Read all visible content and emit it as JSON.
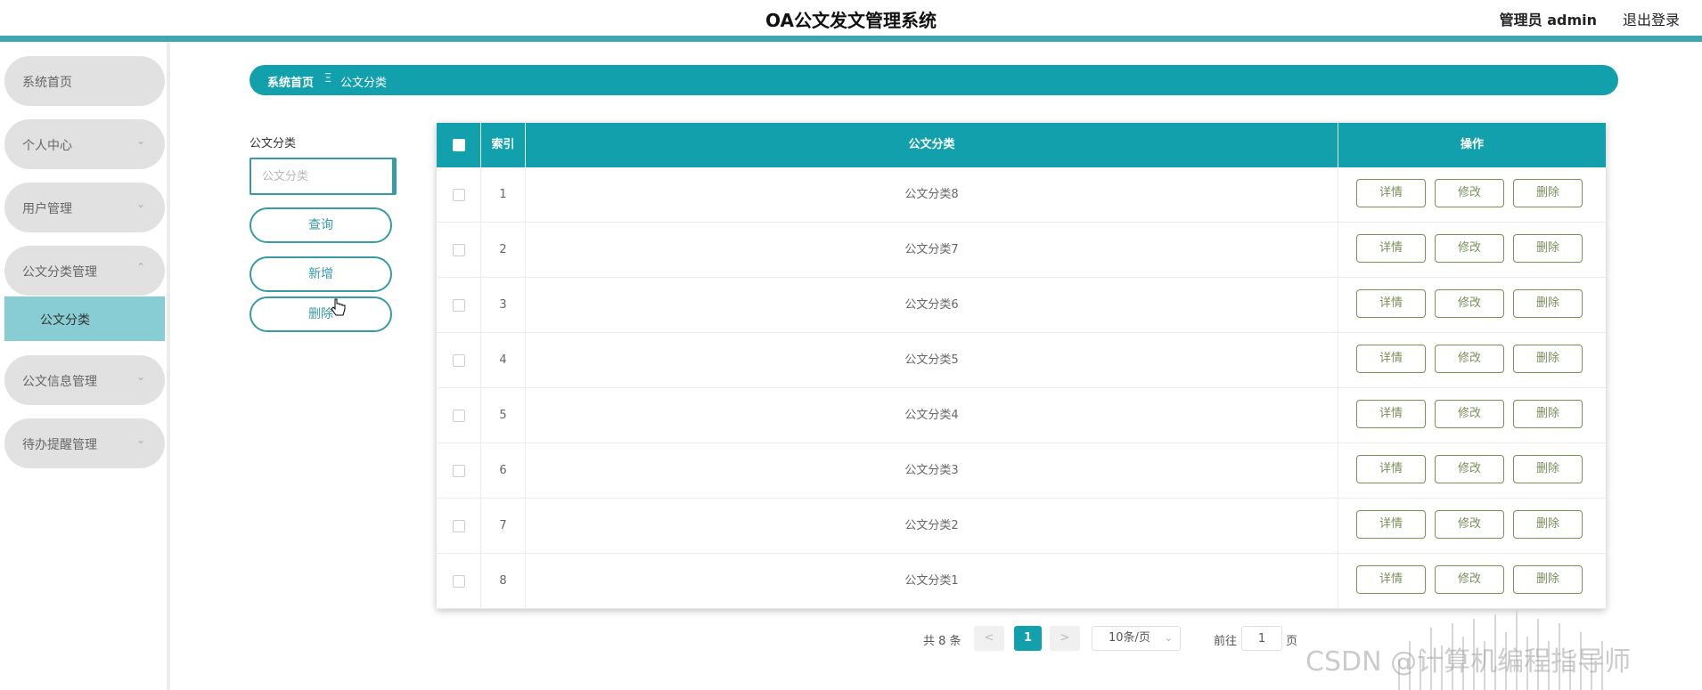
{
  "header": {
    "title": "OA公文发文管理系统",
    "user": "管理员 admin",
    "logout": "退出登录"
  },
  "sidebar": {
    "items": [
      {
        "label": "系统首页",
        "arrow": ""
      },
      {
        "label": "个人中心",
        "arrow": "⌄"
      },
      {
        "label": "用户管理",
        "arrow": "⌄"
      },
      {
        "label": "公文分类管理",
        "arrow": "⌃"
      },
      {
        "label": "公文信息管理",
        "arrow": "⌄"
      },
      {
        "label": "待办提醒管理",
        "arrow": "⌄"
      }
    ],
    "active_sub": "公文分类"
  },
  "breadcrumb": {
    "home": "系统首页",
    "separator": "Ξ",
    "current": "公文分类"
  },
  "search": {
    "label": "公文分类",
    "placeholder": "公文分类",
    "query_button": "查询",
    "add_button": "新增",
    "delete_button": "删除"
  },
  "table": {
    "headers": {
      "index": "索引",
      "name": "公文分类",
      "ops": "操作"
    },
    "rows": [
      {
        "index": "1",
        "name": "公文分类8"
      },
      {
        "index": "2",
        "name": "公文分类7"
      },
      {
        "index": "3",
        "name": "公文分类6"
      },
      {
        "index": "4",
        "name": "公文分类5"
      },
      {
        "index": "5",
        "name": "公文分类4"
      },
      {
        "index": "6",
        "name": "公文分类3"
      },
      {
        "index": "7",
        "name": "公文分类2"
      },
      {
        "index": "8",
        "name": "公文分类1"
      }
    ],
    "ops": {
      "detail": "详情",
      "edit": "修改",
      "delete": "删除"
    }
  },
  "pagination": {
    "total": "共 8 条",
    "prev": "<",
    "next": ">",
    "current_page": "1",
    "page_size": "10条/页",
    "goto_label": "前往",
    "goto_value": "1",
    "goto_unit": "页"
  },
  "watermark": "CSDN @计算机编程指导师",
  "colors": {
    "primary": "#13a0ad",
    "header_bar": "#3fa7b2",
    "sidebar_item": "#e1e1e1",
    "sidebar_active": "#88cdd4",
    "op_button": "#7b8e5a"
  }
}
